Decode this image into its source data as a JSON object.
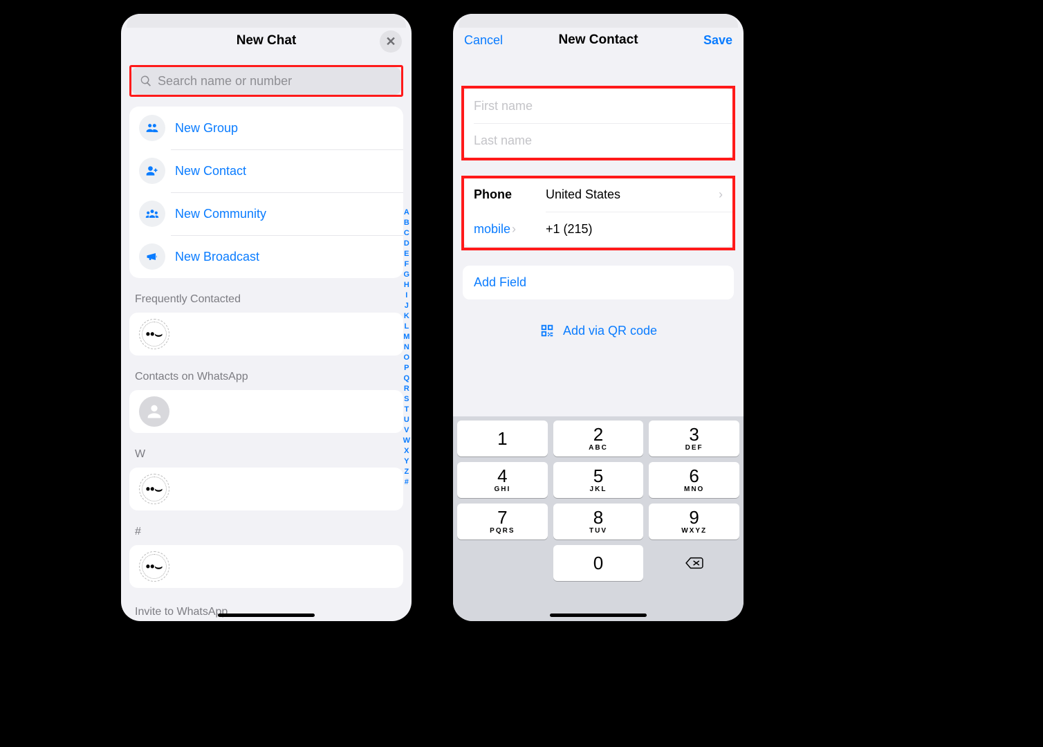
{
  "left": {
    "title": "New Chat",
    "search_placeholder": "Search name or number",
    "actions": {
      "new_group": "New Group",
      "new_contact": "New Contact",
      "new_community": "New Community",
      "new_broadcast": "New Broadcast"
    },
    "sections": {
      "frequently_contacted": "Frequently Contacted",
      "contacts_on_whatsapp": "Contacts on WhatsApp",
      "letter_w": "W",
      "hash": "#",
      "invite": "Invite to WhatsApp"
    },
    "index": [
      "A",
      "B",
      "C",
      "D",
      "E",
      "F",
      "G",
      "H",
      "I",
      "J",
      "K",
      "L",
      "M",
      "N",
      "O",
      "P",
      "Q",
      "R",
      "S",
      "T",
      "U",
      "V",
      "W",
      "X",
      "Y",
      "Z",
      "#"
    ]
  },
  "right": {
    "cancel": "Cancel",
    "title": "New Contact",
    "save": "Save",
    "first_name_placeholder": "First name",
    "last_name_placeholder": "Last name",
    "phone_label": "Phone",
    "country_value": "United States",
    "mobile_label": "mobile",
    "phone_value": "+1  (215)",
    "add_field": "Add Field",
    "add_via_qr": "Add via QR code",
    "keypad": [
      {
        "digit": "1",
        "letters": ""
      },
      {
        "digit": "2",
        "letters": "ABC"
      },
      {
        "digit": "3",
        "letters": "DEF"
      },
      {
        "digit": "4",
        "letters": "GHI"
      },
      {
        "digit": "5",
        "letters": "JKL"
      },
      {
        "digit": "6",
        "letters": "MNO"
      },
      {
        "digit": "7",
        "letters": "PQRS"
      },
      {
        "digit": "8",
        "letters": "TUV"
      },
      {
        "digit": "9",
        "letters": "WXYZ"
      },
      {
        "digit": "0",
        "letters": ""
      }
    ]
  }
}
